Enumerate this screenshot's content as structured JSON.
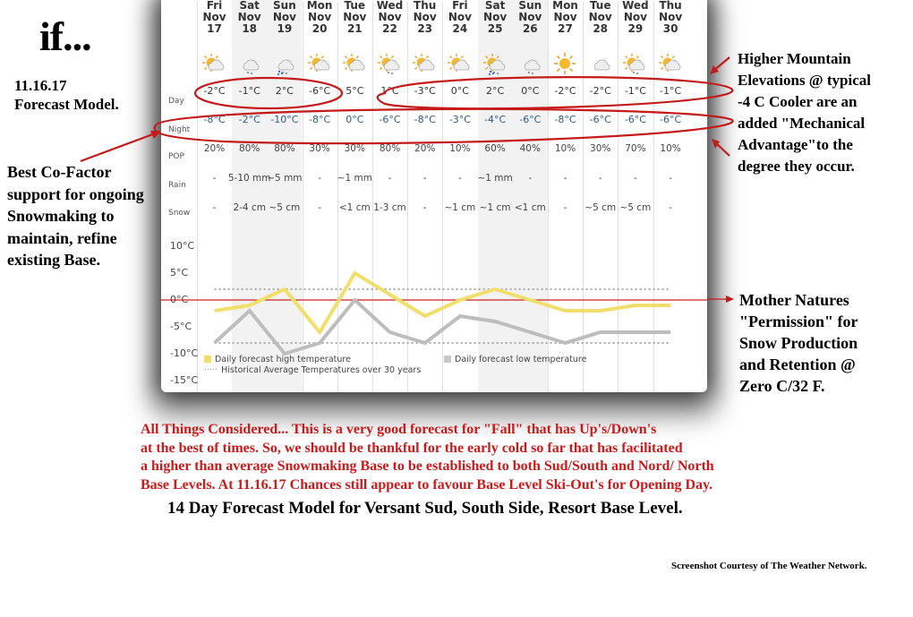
{
  "forecast": {
    "row_labels": {
      "day": "Day",
      "night": "Night",
      "pop": "POP",
      "rain": "Rain",
      "snow": "Snow"
    },
    "days": [
      {
        "dow": "Fri",
        "mon": "Nov",
        "date": "17",
        "icon": "sun-cloud-icon",
        "day": "-2°C",
        "night": "-8°C",
        "pop": "20%",
        "rain": "-",
        "snow": "-",
        "weekend": false
      },
      {
        "dow": "Sat",
        "mon": "Nov",
        "date": "18",
        "icon": "cloud-snow-icon",
        "day": "-1°C",
        "night": "-2°C",
        "pop": "80%",
        "rain": "5-10 mm",
        "snow": "2-4 cm",
        "weekend": true
      },
      {
        "dow": "Sun",
        "mon": "Nov",
        "date": "19",
        "icon": "cloud-rain-snow-icon",
        "day": "2°C",
        "night": "-10°C",
        "pop": "80%",
        "rain": "~5 mm",
        "snow": "~5 cm",
        "weekend": true
      },
      {
        "dow": "Mon",
        "mon": "Nov",
        "date": "20",
        "icon": "sun-cloud-icon",
        "day": "-6°C",
        "night": "-8°C",
        "pop": "30%",
        "rain": "-",
        "snow": "-",
        "weekend": false
      },
      {
        "dow": "Tue",
        "mon": "Nov",
        "date": "21",
        "icon": "sun-cloud-icon",
        "day": "5°C",
        "night": "0°C",
        "pop": "30%",
        "rain": "~1 mm",
        "snow": "<1 cm",
        "weekend": false
      },
      {
        "dow": "Wed",
        "mon": "Nov",
        "date": "22",
        "icon": "sun-cloud-snow-icon",
        "day": "1°C",
        "night": "-6°C",
        "pop": "80%",
        "rain": "-",
        "snow": "1-3 cm",
        "weekend": false
      },
      {
        "dow": "Thu",
        "mon": "Nov",
        "date": "23",
        "icon": "sun-cloud-icon",
        "day": "-3°C",
        "night": "-8°C",
        "pop": "20%",
        "rain": "-",
        "snow": "-",
        "weekend": false
      },
      {
        "dow": "Fri",
        "mon": "Nov",
        "date": "24",
        "icon": "sun-cloud-icon",
        "day": "0°C",
        "night": "-3°C",
        "pop": "10%",
        "rain": "-",
        "snow": "~1 cm",
        "weekend": false
      },
      {
        "dow": "Sat",
        "mon": "Nov",
        "date": "25",
        "icon": "sun-cloud-rain-snow-icon",
        "day": "2°C",
        "night": "-4°C",
        "pop": "60%",
        "rain": "~1 mm",
        "snow": "~1 cm",
        "weekend": true
      },
      {
        "dow": "Sun",
        "mon": "Nov",
        "date": "26",
        "icon": "cloud-snow-icon",
        "day": "0°C",
        "night": "-6°C",
        "pop": "40%",
        "rain": "-",
        "snow": "<1 cm",
        "weekend": true
      },
      {
        "dow": "Mon",
        "mon": "Nov",
        "date": "27",
        "icon": "sun-icon",
        "day": "-2°C",
        "night": "-8°C",
        "pop": "10%",
        "rain": "-",
        "snow": "-",
        "weekend": false
      },
      {
        "dow": "Tue",
        "mon": "Nov",
        "date": "28",
        "icon": "cloud-icon",
        "day": "-2°C",
        "night": "-6°C",
        "pop": "30%",
        "rain": "-",
        "snow": "~5 cm",
        "weekend": false
      },
      {
        "dow": "Wed",
        "mon": "Nov",
        "date": "29",
        "icon": "sun-cloud-snow-icon",
        "day": "-1°C",
        "night": "-6°C",
        "pop": "70%",
        "rain": "-",
        "snow": "~5 cm",
        "weekend": false
      },
      {
        "dow": "Thu",
        "mon": "Nov",
        "date": "30",
        "icon": "sun-cloud-icon",
        "day": "-1°C",
        "night": "-6°C",
        "pop": "10%",
        "rain": "-",
        "snow": "-",
        "weekend": false
      }
    ]
  },
  "chart_data": {
    "type": "line",
    "x": [
      "Nov 17",
      "Nov 18",
      "Nov 19",
      "Nov 20",
      "Nov 21",
      "Nov 22",
      "Nov 23",
      "Nov 24",
      "Nov 25",
      "Nov 26",
      "Nov 27",
      "Nov 28",
      "Nov 29",
      "Nov 30"
    ],
    "series": [
      {
        "name": "Daily forecast high temperature",
        "color": "#f2df6b",
        "values": [
          -2,
          -1,
          2,
          -6,
          5,
          1,
          -3,
          0,
          2,
          0,
          -2,
          -2,
          -1,
          -1
        ]
      },
      {
        "name": "Daily forecast low temperature",
        "color": "#bdbdbd",
        "values": [
          -8,
          -2,
          -10,
          -8,
          0,
          -6,
          -8,
          -3,
          -4,
          -6,
          -8,
          -6,
          -6,
          -6
        ]
      }
    ],
    "historical_average": {
      "name": "Historical Average Temperatures over 30 years",
      "high": 2,
      "low": -8
    },
    "reference_line": {
      "value": 0,
      "color": "#cc2222"
    },
    "yticks": [
      "10°C",
      "5°C",
      "0°C",
      "-5°C",
      "-10°C",
      "-15°C"
    ],
    "ylim": [
      -15,
      10
    ],
    "legend": {
      "high": "Daily forecast high temperature",
      "low": "Daily forecast low temperature",
      "hist": "Historical Average Temperatures over 30 years"
    }
  },
  "annotations": {
    "title": "if...",
    "date_note": [
      "11.16.17",
      "Forecast Model."
    ],
    "left_note": [
      "Best Co-Factor",
      "support for ongoing",
      "Snowmaking to",
      "maintain, refine",
      "existing Base."
    ],
    "right_top": [
      "Higher Mountain",
      "Elevations @ typical",
      "-4 C Cooler are an",
      "added \"Mechanical",
      "Advantage\"to the",
      "degree they occur."
    ],
    "right_mid": [
      "Mother Natures",
      "\"Permission\" for",
      "Snow Production",
      "and Retention @",
      "Zero C/32 F."
    ],
    "red_note": [
      "All Things Considered... This is a very good forecast for \"Fall\" that has Up's/Down's",
      "at the best of times. So, we should be thankful for the early cold so far that has facilitated",
      "a higher than average Snowmaking Base to be established to both Sud/South and Nord/ North",
      "Base Levels. At 11.16.17 Chances still appear to favour Base Level Ski-Out's for Opening Day."
    ],
    "caption": "14 Day Forecast Model for Versant Sud, South Side, Resort Base Level.",
    "credit": "Screenshot Courtesy of The Weather Network."
  }
}
